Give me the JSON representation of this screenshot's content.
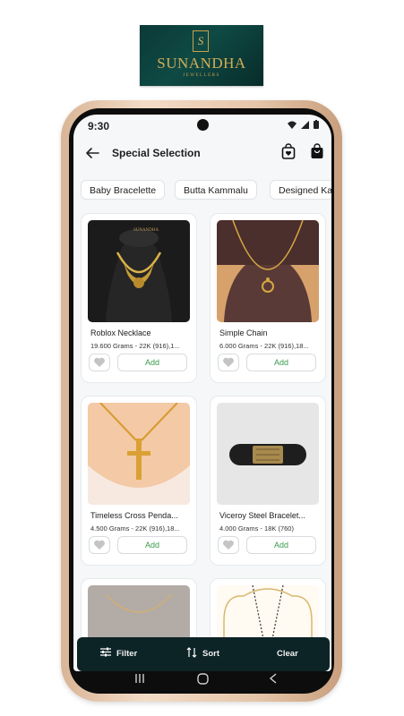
{
  "brand": {
    "name": "SUNANDHA",
    "tagline": "JEWELLERS",
    "monogram": "S"
  },
  "status_bar": {
    "time": "9:30"
  },
  "header": {
    "title": "Special Selection"
  },
  "chips": [
    "Baby Bracelette",
    "Butta Kammalu",
    "Designed Ka"
  ],
  "products": [
    {
      "name": "Roblox Necklace",
      "info": "19.600 Grams - 22K (916),1...",
      "add_label": "Add"
    },
    {
      "name": "Simple Chain",
      "info": "6.000 Grams - 22K (916),18...",
      "add_label": "Add"
    },
    {
      "name": "Timeless Cross Penda...",
      "info": "4.500 Grams - 22K (916),18...",
      "add_label": "Add"
    },
    {
      "name": "Viceroy Steel Bracelet...",
      "info": "4.000 Grams - 18K (760)",
      "add_label": "Add"
    }
  ],
  "bottom_bar": {
    "filter": "Filter",
    "sort": "Sort",
    "clear": "Clear"
  },
  "colors": {
    "accent_green": "#3a9a4c",
    "bar": "#0d2427",
    "brand_gold": "#d4ad55",
    "brand_teal": "#0f4a45"
  }
}
